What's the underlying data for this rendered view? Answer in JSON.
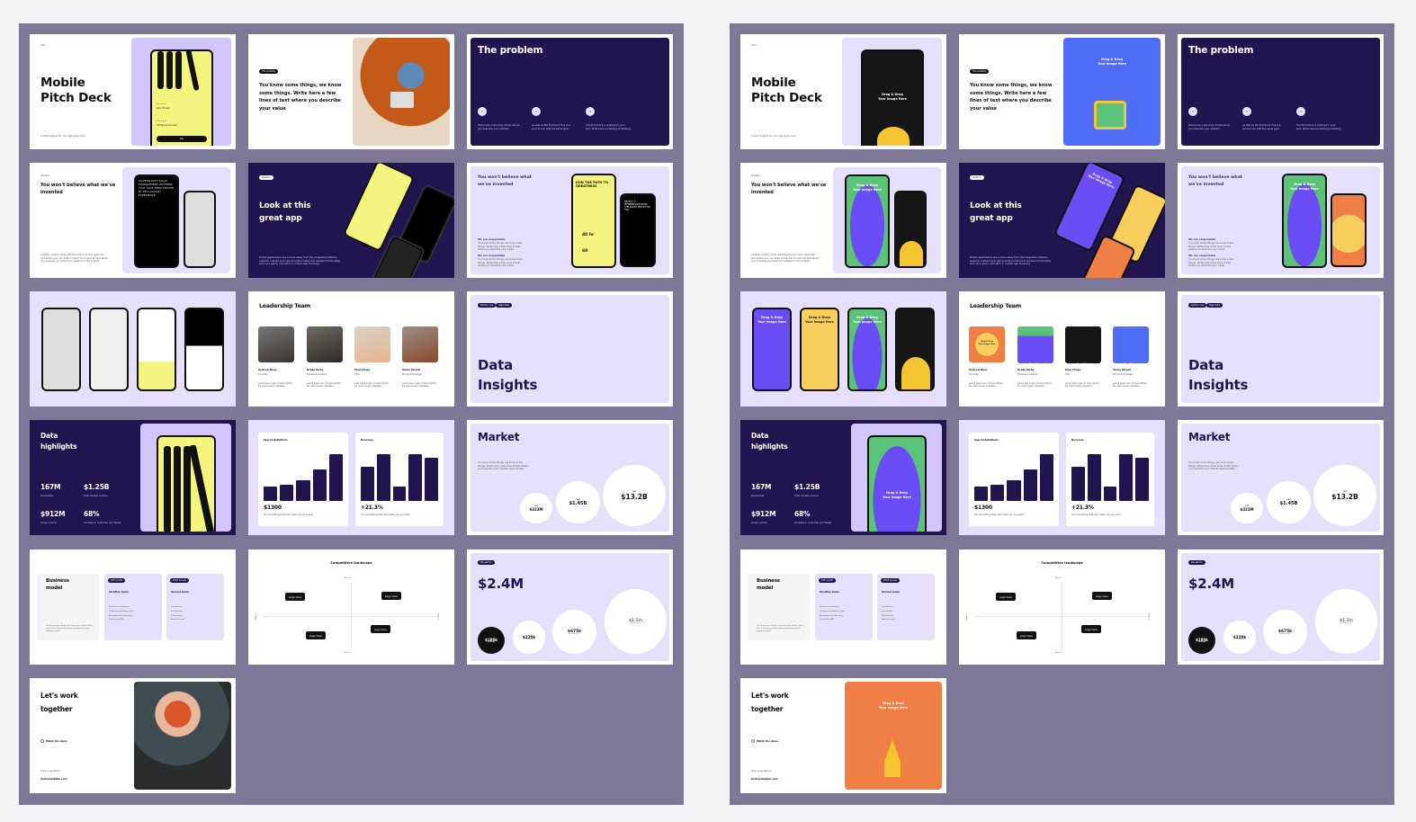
{
  "placeholder": "Drag & Drop\nYour Image Here",
  "colors": {
    "panel": "#7e7898",
    "dark_purple": "#21154f",
    "lavender": "#e6e0fd",
    "yellow": "#f3f57f",
    "placeholder_blue": "#4f6cf5",
    "placeholder_orange": "#ef7f45",
    "placeholder_green": "#5bc27a"
  },
  "slides": {
    "cover": {
      "tag": "Intro",
      "title": "Mobile\nPitch Deck",
      "subtitle": "A short tagline for your app goes here",
      "phone_name_label": "Your name",
      "phone_name": "John Turner",
      "phone_email_label": "Your E-mail",
      "phone_email": "info@yourdomain",
      "phone_button": "Join"
    },
    "problem_intro": {
      "tag": "The problem",
      "text": "You know some things, we know some things. Write here a few lines of text where you describe your value"
    },
    "problem": {
      "title": "The problem",
      "items": [
        {
          "num": "1",
          "text": "Write here a few lines of text where you describe your problem"
        },
        {
          "num": "2",
          "text": "As well as the first block this is a second one with the same goal"
        },
        {
          "num": "3",
          "text": "The third block is waiting for your text. Write here something motivating"
        }
      ]
    },
    "solution": {
      "tag": "Solution",
      "title": "You won't believe what we've invented",
      "text": "Another solution slide with the phone on the right side and where you can write content and a second text about your solution and what you realized in this project."
    },
    "app": {
      "tag": "Solution",
      "title": "Look at this\ngreat app",
      "text": "Mobile applications are a move away from the integrated software systems. Instead each app provides limited and isolated functionality such as a game, calculator or mobile web browsing."
    },
    "invented": {
      "title": "You won't believe what we've invented",
      "blocks": [
        {
          "title": "We are responsible",
          "text": "You know some things, we know some things. Write here a few lines of text where you describe your value"
        },
        {
          "title": "We are responsible",
          "text": "You know some things, we know some things. Write here a few lines of text where you describe your value"
        }
      ],
      "phone_heading": "JOIN THE PATH TO GREATNESS",
      "stat1": "40 hr",
      "stat2": "60",
      "phone2_heading": "SELECT A MEMBERSHIP LEVEL THE RIGHT PRICE FOR YOU"
    },
    "team": {
      "title": "Leadership Team",
      "members": [
        {
          "name": "Andrew Ness",
          "role": "Founder",
          "desc": "Just a few lines of description for each team member"
        },
        {
          "name": "Drake Kirby",
          "role": "Business analyst",
          "desc": "Just a few lines of description for each team member"
        },
        {
          "name": "Paul Chase",
          "role": "CTO",
          "desc": "Just a few lines of description for each team member"
        },
        {
          "name": "Annie Street",
          "role": "Product manager",
          "desc": "Just a few lines of description for each team member"
        }
      ]
    },
    "insights": {
      "tags": [
        "Section one",
        "Page data"
      ],
      "title": "Data\nInsights"
    },
    "highlights": {
      "title": "Data\nhighlights",
      "stats": [
        {
          "value": "167M",
          "label": "Downloads"
        },
        {
          "value": "$1.25B",
          "label": "Total market volume"
        },
        {
          "value": "$912M",
          "label": "Gross income"
        },
        {
          "value": "68%",
          "label": "Increase in customer purchases"
        }
      ]
    },
    "charts": {
      "installs": {
        "title": "App installations",
        "bars": [
          30,
          35,
          45,
          68,
          100
        ],
        "value": "$1300",
        "caption": "It's something that will make you succeed"
      },
      "revenue": {
        "title": "Revenue",
        "bars": [
          70,
          96,
          30,
          96,
          88
        ],
        "value": "+21.3%",
        "caption": "It's something that will make you succeed"
      }
    },
    "market": {
      "title": "Market",
      "text": "You know some things, we know some things. Write here a few lines of text where you describe your market opportunities",
      "circles": [
        {
          "label": "SOM",
          "value": "$323M"
        },
        {
          "label": "SAM",
          "value": "$1.45B"
        },
        {
          "label": "TAM",
          "value": "$13.2B"
        }
      ]
    },
    "business": {
      "title": "Business\nmodel",
      "text": "You know some things, we know some things. Write here a few lines of text where you describe your business model",
      "plans": [
        {
          "badge": "$45 month",
          "title": "Monthly basis",
          "features": [
            "Products on Instagram",
            "Unlimited availability views",
            "Abandoned Cart Recovery",
            "Conversions API"
          ]
        },
        {
          "badge": "$545 annual",
          "title": "Annual basis",
          "features": [
            "Contribution",
            "Free domain",
            "500 Products",
            "And other stuff"
          ]
        }
      ]
    },
    "competitive": {
      "title": "Competitive landscape",
      "axes": [
        "Metric 1",
        "Metric 2",
        "Metric 3",
        "Metric 4"
      ],
      "logo": "Logo here"
    },
    "funding": {
      "tag": "We ask for",
      "title": "$2.4M",
      "circles": [
        {
          "value": "$180k",
          "label": "Marketing"
        },
        {
          "value": "$320k",
          "label": "Development"
        },
        {
          "value": "$675k",
          "label": "Something else"
        },
        {
          "value": "$1.1m",
          "label": "Something else"
        }
      ]
    },
    "contact": {
      "title": "Let's work\ntogether",
      "demo": "Watch the demo",
      "question": "Have a question?",
      "email": "hello@slidddo.com"
    }
  }
}
